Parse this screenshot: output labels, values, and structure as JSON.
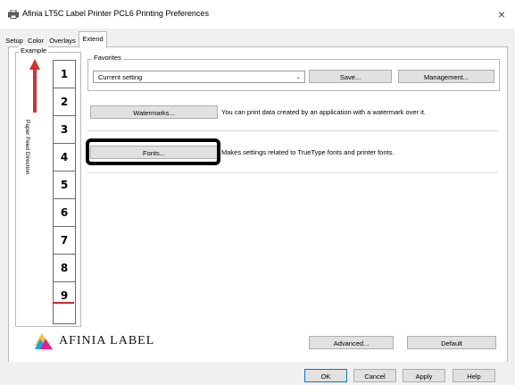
{
  "window": {
    "title": "Afinia LT5C Label Printer PCL6 Printing Preferences",
    "close_glyph": "×"
  },
  "tabs": [
    {
      "label": "Setup"
    },
    {
      "label": "Color"
    },
    {
      "label": "Overlays"
    },
    {
      "label": "Extend",
      "active": true
    }
  ],
  "example": {
    "label": "Example",
    "feed_direction_label": "Paper Feed Direction",
    "cells": [
      "1",
      "2",
      "3",
      "4",
      "5",
      "6",
      "7",
      "8",
      "9"
    ]
  },
  "favorites": {
    "label": "Favorites",
    "selected": "Current setting",
    "save_label": "Save...",
    "management_label": "Management..."
  },
  "watermarks": {
    "button_label": "Watermarks...",
    "description": "You can print data created by an application with a watermark over it."
  },
  "fonts": {
    "button_label": "Fonts...",
    "description": "Makes settings related to TrueType fonts and printer fonts."
  },
  "logo": {
    "text": "AFINIA LABEL"
  },
  "buttons": {
    "advanced": "Advanced...",
    "default": "Default",
    "ok": "OK",
    "cancel": "Cancel",
    "apply": "Apply",
    "help": "Help"
  },
  "colors": {
    "arrow_red": "#d32f2f",
    "highlight": "#000000",
    "ok_border": "#0078d7"
  }
}
